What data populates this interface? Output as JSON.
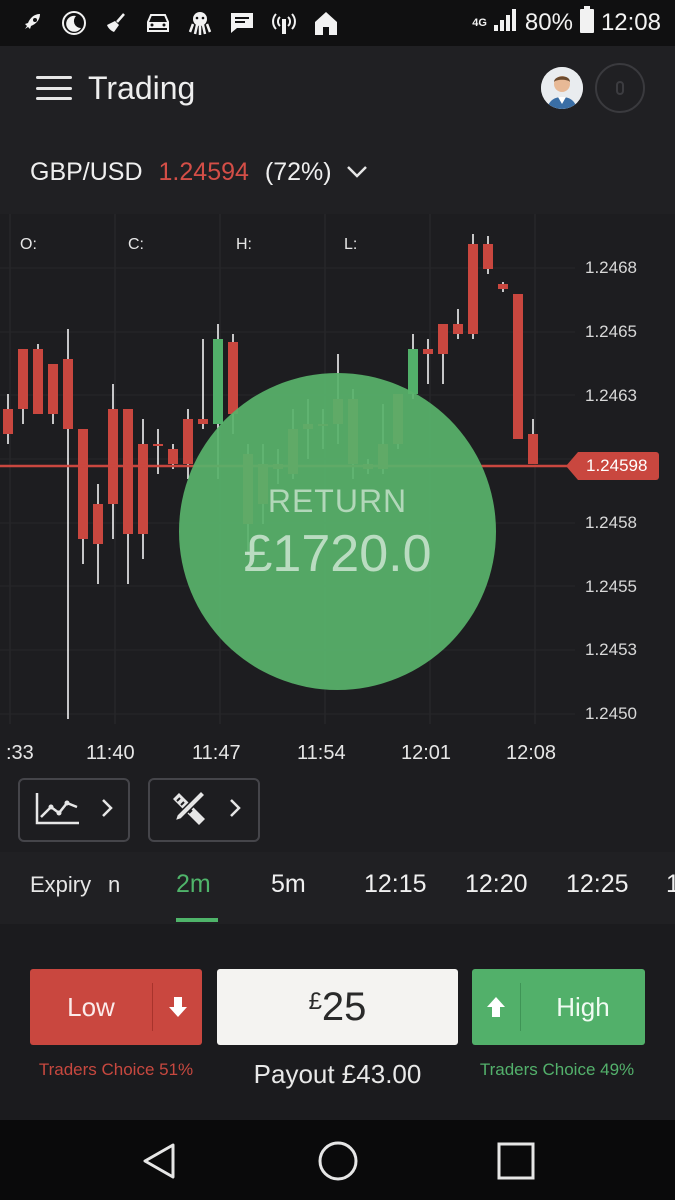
{
  "status_bar": {
    "battery": "80%",
    "time": "12:08",
    "network": "4G",
    "icons": [
      "rocket-icon",
      "moon-icon",
      "broom-icon",
      "car-icon",
      "octopus-icon",
      "message-icon",
      "signal-wave-icon",
      "home-icon"
    ]
  },
  "app": {
    "title": "Trading"
  },
  "asset": {
    "pair": "GBP/USD",
    "price": "1.24594",
    "percent": "(72%)"
  },
  "chart": {
    "ohlc_labels": [
      "O:",
      "C:",
      "H:",
      "L:"
    ],
    "price_labels": [
      "1.2468",
      "1.2465",
      "1.2463",
      "1.2458",
      "1.2455",
      "1.2453",
      "1.2450"
    ],
    "current_price_tag": "1.24598",
    "time_labels": [
      ":33",
      "11:40",
      "11:47",
      "11:54",
      "12:01",
      "12:08"
    ],
    "colors": {
      "up": "#52b06a",
      "down": "#c9473f",
      "price_line": "#c9473f"
    }
  },
  "overlay": {
    "label": "RETURN",
    "value": "£1720.0"
  },
  "tools": {
    "indicator_icon": "line-chart-icon",
    "drawing_icon": "ruler-pencil-icon"
  },
  "expiry": {
    "label": "Expiry",
    "label_cut": "n",
    "options": [
      "2m",
      "5m",
      "12:15",
      "12:20",
      "12:25"
    ],
    "selected": "2m"
  },
  "trade": {
    "low_label": "Low",
    "high_label": "High",
    "currency": "£",
    "amount": "25",
    "payout": "Payout £43.00",
    "low_choice": "Traders Choice 51%",
    "high_choice": "Traders Choice 49%"
  }
}
